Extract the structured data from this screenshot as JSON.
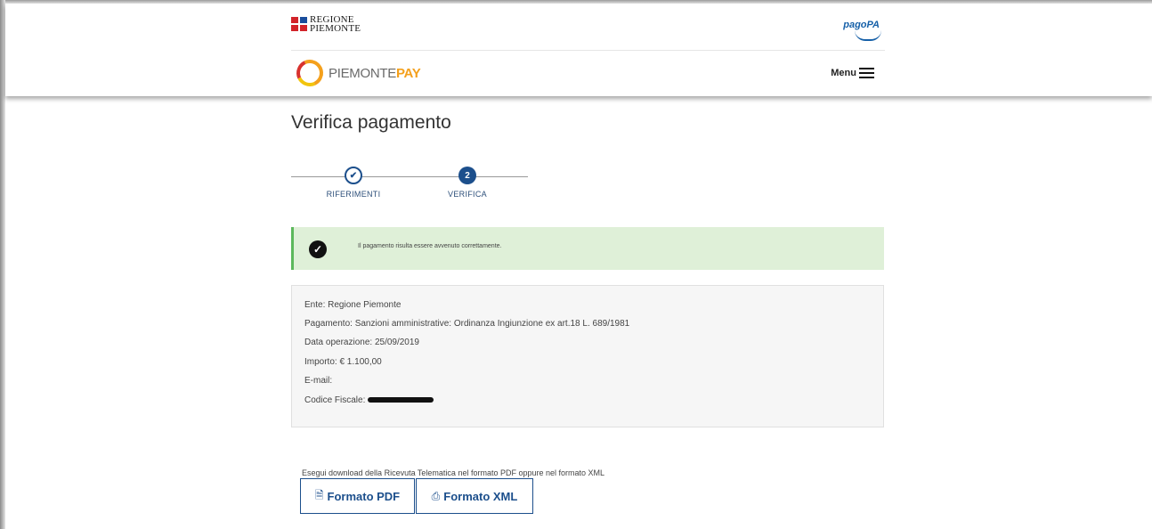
{
  "header": {
    "regione_line1": "REGIONE",
    "regione_line2": "PIEMONTE",
    "pagopa": "pagoPA",
    "brand_main": "PIEMONTE",
    "brand_pay": "PAY",
    "menu_label": "Menu"
  },
  "page": {
    "title": "Verifica pagamento"
  },
  "stepper": {
    "steps": [
      {
        "label": "RIFERIMENTI",
        "state": "done",
        "icon": "check-icon"
      },
      {
        "label": "VERIFICA",
        "number": "2",
        "state": "active"
      }
    ]
  },
  "alert": {
    "icon": "check-circle-icon",
    "message": "Il pagamento risulta essere avvenuto correttamente."
  },
  "details": {
    "ente": "Ente: Regione Piemonte",
    "pagamento": "Pagamento: Sanzioni amministrative: Ordinanza Ingiunzione ex art.18 L. 689/1981",
    "data": "Data operazione: 25/09/2019",
    "importo": "Importo: € 1.100,00",
    "email": "E-mail:",
    "codice_fiscale_label": "Codice Fiscale:"
  },
  "download": {
    "text": "Esegui download della Ricevuta Telematica nel formato PDF oppure nel formato XML",
    "pdf_label": "Formato PDF",
    "xml_label": "Formato XML"
  },
  "colors": {
    "primary": "#1c4f8c",
    "alert_bg": "#dff0d8",
    "alert_border": "#5cb85c",
    "brand_orange": "#f4a01c"
  }
}
